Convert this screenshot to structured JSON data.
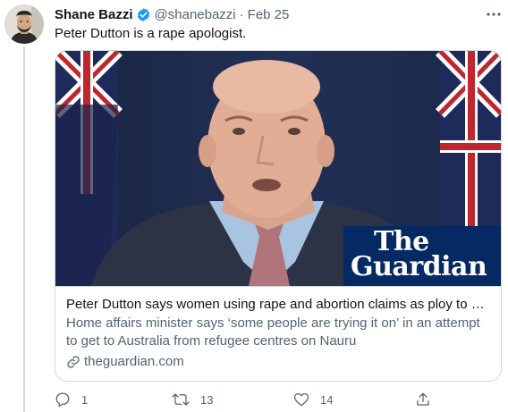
{
  "tweet": {
    "display_name": "Shane Bazzi",
    "handle": "@shanebazzi",
    "separator": "·",
    "date": "Feb 25",
    "text": "Peter Dutton is a rape apologist.",
    "verified_icon": "verified-badge-icon",
    "more_icon": "more-dots-icon"
  },
  "card": {
    "logo_line1": "The",
    "logo_line2": "Guardian",
    "title": "Peter Dutton says women using rape and abortion claims as ploy to ge...",
    "description": "Home affairs minister says ‘some people are trying it on’ in an attempt to get to Australia from refugee centres on Nauru",
    "domain": "theguardian.com"
  },
  "actions": {
    "reply_count": "1",
    "retweet_count": "13",
    "like_count": "14"
  },
  "colors": {
    "accent": "#1d9bf0",
    "secondary_text": "#536471",
    "guardian_blue": "#052962"
  }
}
